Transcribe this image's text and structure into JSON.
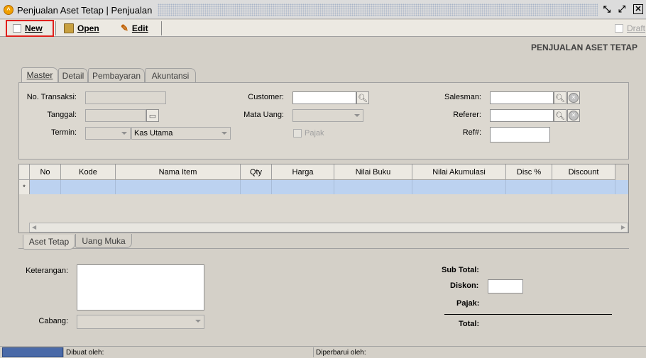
{
  "window": {
    "title": "Penjualan Aset Tetap | Penjualan"
  },
  "toolbar": {
    "new_label": "New",
    "open_label": "Open",
    "edit_label": "Edit",
    "draft_label": "Draft"
  },
  "form": {
    "title": "PENJUALAN ASET TETAP"
  },
  "tabs": [
    {
      "label": "Master",
      "active": true
    },
    {
      "label": "Detail",
      "active": false
    },
    {
      "label": "Pembayaran",
      "active": false
    },
    {
      "label": "Akuntansi",
      "active": false
    }
  ],
  "master": {
    "no_transaksi_label": "No. Transaksi:",
    "tanggal_label": "Tanggal:",
    "termin_label": "Termin:",
    "termin_value": "Kas Utama",
    "customer_label": "Customer:",
    "mata_uang_label": "Mata Uang:",
    "pajak_label": "Pajak",
    "salesman_label": "Salesman:",
    "referer_label": "Referer:",
    "ref_label": "Ref#:"
  },
  "grid": {
    "columns": [
      "No",
      "Kode",
      "Nama Item",
      "Qty",
      "Harga",
      "Nilai Buku",
      "Nilai Akumulasi",
      "Disc %",
      "Discount"
    ],
    "new_row_marker": "*"
  },
  "subtabs": [
    {
      "label": "Aset Tetap",
      "active": true
    },
    {
      "label": "Uang Muka",
      "active": false
    }
  ],
  "bottom": {
    "keterangan_label": "Keterangan:",
    "cabang_label": "Cabang:",
    "sub_total_label": "Sub Total:",
    "diskon_label": "Diskon:",
    "pajak_label": "Pajak:",
    "total_label": "Total:"
  },
  "status": {
    "dibuat_label": "Dibuat oleh:",
    "diperbarui_label": "Diperbarui oleh:"
  },
  "colors": {
    "highlight": "#e0201c",
    "selected_row": "#bcd2f0"
  }
}
